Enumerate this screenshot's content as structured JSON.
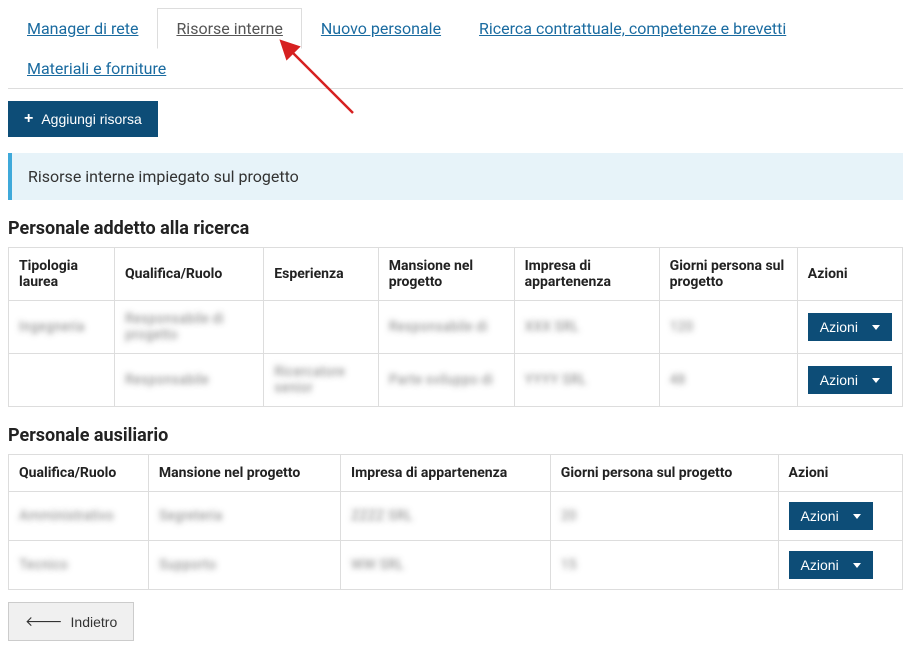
{
  "tabs": {
    "items": [
      {
        "label": "Manager di rete"
      },
      {
        "label": "Risorse interne",
        "active": true
      },
      {
        "label": "Nuovo personale"
      },
      {
        "label": "Ricerca contrattuale, competenze e brevetti"
      },
      {
        "label": "Materiali e forniture"
      }
    ]
  },
  "toolbar": {
    "add_button_label": "Aggiungi risorsa"
  },
  "info_bar": "Risorse interne impiegato sul progetto",
  "section1": {
    "title": "Personale addetto alla ricerca",
    "columns": {
      "tipologia": "Tipologia laurea",
      "qualifica": "Qualifica/Ruolo",
      "esperienza": "Esperienza",
      "mansione": "Mansione nel progetto",
      "impresa": "Impresa di appartenenza",
      "giorni": "Giorni persona sul progetto",
      "azioni": "Azioni"
    },
    "rows": [
      {
        "tipologia": "Ingegneria",
        "qualifica": "Responsabile di progetto",
        "esperienza": "",
        "mansione": "Responsabile di",
        "impresa": "XXX SRL",
        "giorni": "120"
      },
      {
        "tipologia": "",
        "qualifica": "Responsabile",
        "esperienza": "Ricercatore senior",
        "mansione": "Parte sviluppo di",
        "impresa": "YYYY SRL",
        "giorni": "48"
      }
    ],
    "action_label": "Azioni"
  },
  "section2": {
    "title": "Personale ausiliario",
    "columns": {
      "qualifica": "Qualifica/Ruolo",
      "mansione": "Mansione nel progetto",
      "impresa": "Impresa di appartenenza",
      "giorni": "Giorni persona sul progetto",
      "azioni": "Azioni"
    },
    "rows": [
      {
        "qualifica": "Amministrativo",
        "mansione": "Segreteria",
        "impresa": "ZZZZ SRL",
        "giorni": "20"
      },
      {
        "qualifica": "Tecnico",
        "mansione": "Supporto",
        "impresa": "WW SRL",
        "giorni": "15"
      }
    ],
    "action_label": "Azioni"
  },
  "footer": {
    "back_label": "Indietro"
  }
}
